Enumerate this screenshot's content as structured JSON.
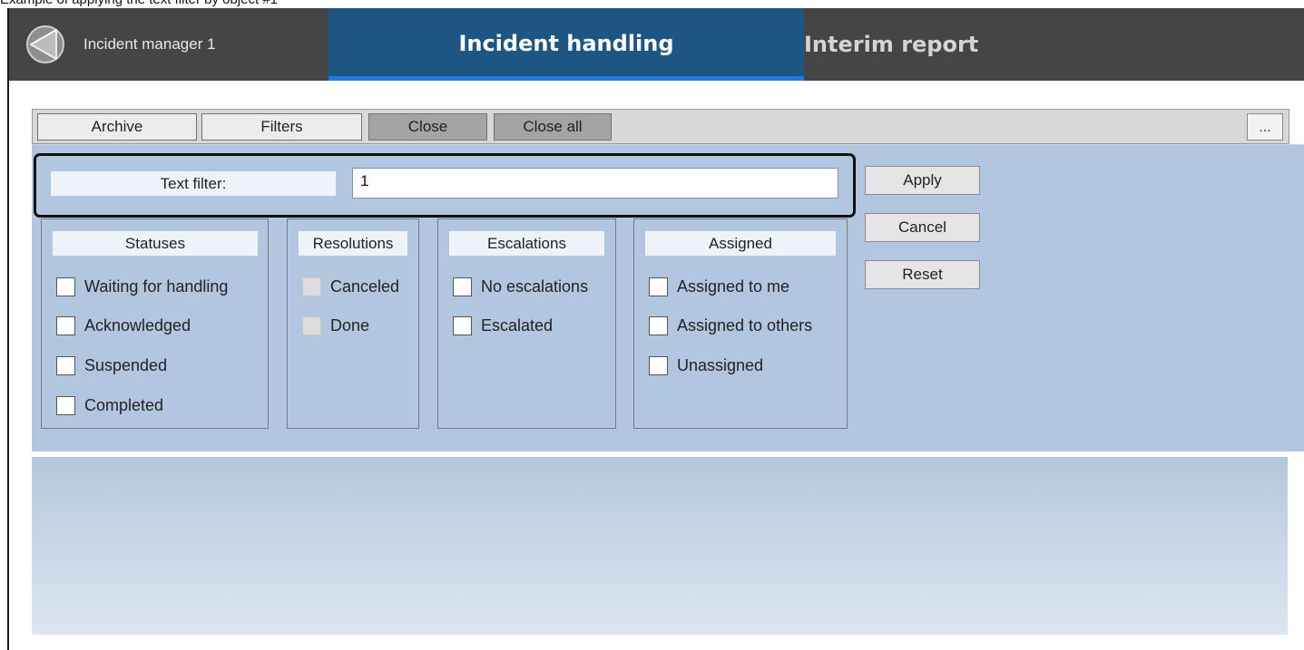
{
  "caption": "Example of applying the text filter by object #1",
  "app": {
    "title": "Incident manager 1",
    "logo_icon": "sphere-logo-icon"
  },
  "tabs": [
    {
      "label": "Incident handling",
      "active": true
    },
    {
      "label": "Interim report",
      "active": false
    }
  ],
  "toolbar": {
    "archive_label": "Archive",
    "filters_label": "Filters",
    "close_label": "Close",
    "close_all_label": "Close all",
    "more_label": "..."
  },
  "text_filter": {
    "label": "Text filter:",
    "value": "1"
  },
  "actions": {
    "apply_label": "Apply",
    "cancel_label": "Cancel",
    "reset_label": "Reset"
  },
  "groups": {
    "statuses": {
      "title": "Statuses",
      "items": [
        "Waiting for handling",
        "Acknowledged",
        "Suspended",
        "Completed"
      ]
    },
    "resolutions": {
      "title": "Resolutions",
      "items": [
        "Canceled",
        "Done"
      ]
    },
    "escalations": {
      "title": "Escalations",
      "items": [
        "No escalations",
        "Escalated"
      ]
    },
    "assigned": {
      "title": "Assigned",
      "items": [
        "Assigned to me",
        "Assigned to others",
        "Unassigned"
      ]
    }
  },
  "colors": {
    "titlebar": "#454545",
    "active_tab": "#1e5683",
    "active_tab_underline": "#1e7be0",
    "filter_panel": "#b3c6df"
  }
}
